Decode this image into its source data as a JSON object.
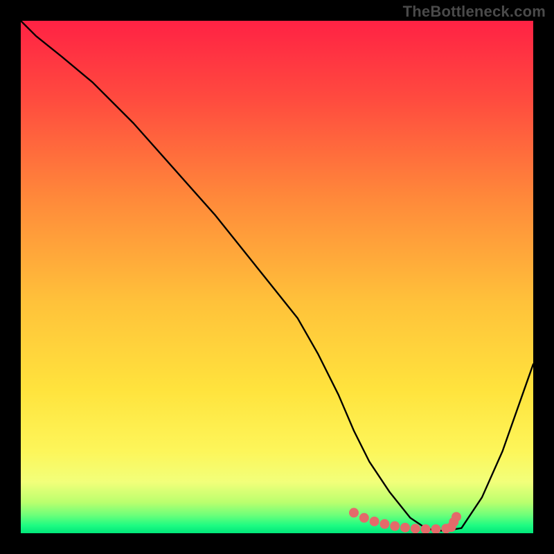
{
  "watermark": "TheBottleneck.com",
  "gradient": {
    "stops": [
      {
        "offset": 0.0,
        "color": "#ff2244"
      },
      {
        "offset": 0.15,
        "color": "#ff4a3f"
      },
      {
        "offset": 0.35,
        "color": "#ff8a3a"
      },
      {
        "offset": 0.55,
        "color": "#ffc23a"
      },
      {
        "offset": 0.72,
        "color": "#ffe33d"
      },
      {
        "offset": 0.84,
        "color": "#fdf65a"
      },
      {
        "offset": 0.9,
        "color": "#f2ff7a"
      },
      {
        "offset": 0.94,
        "color": "#baff6e"
      },
      {
        "offset": 0.965,
        "color": "#6cff7a"
      },
      {
        "offset": 0.985,
        "color": "#1dfb82"
      },
      {
        "offset": 1.0,
        "color": "#00e67a"
      }
    ]
  },
  "chart_data": {
    "type": "line",
    "title": "",
    "xlabel": "",
    "ylabel": "",
    "xlim": [
      0,
      100
    ],
    "ylim": [
      0,
      100
    ],
    "series": [
      {
        "name": "curve",
        "x": [
          0,
          3,
          8,
          14,
          22,
          30,
          38,
          46,
          54,
          58,
          62,
          65,
          68,
          72,
          76,
          79,
          81,
          83,
          86,
          90,
          94,
          100
        ],
        "y": [
          100,
          97,
          93,
          88,
          80,
          71,
          62,
          52,
          42,
          35,
          27,
          20,
          14,
          8,
          3,
          1,
          0.5,
          0.5,
          1,
          7,
          16,
          33
        ]
      }
    ],
    "markers": {
      "name": "dots",
      "x": [
        65,
        67,
        69,
        71,
        73,
        75,
        77,
        79,
        81,
        83,
        84,
        84.5,
        85
      ],
      "y": [
        4,
        3,
        2.3,
        1.8,
        1.4,
        1.1,
        0.9,
        0.8,
        0.8,
        0.9,
        1.2,
        2.2,
        3.2
      ]
    }
  },
  "style": {
    "marker_color": "#e46a6a",
    "marker_radius": 7,
    "line_color": "#000000",
    "line_width": 2.4
  }
}
